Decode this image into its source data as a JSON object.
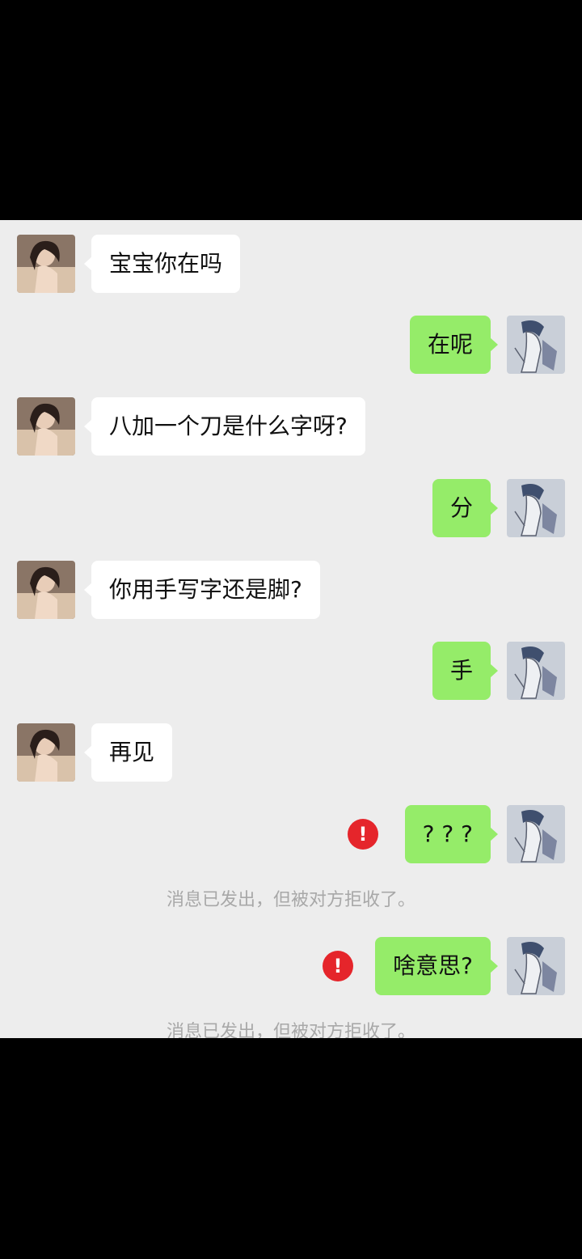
{
  "messages": [
    {
      "side": "in",
      "text": "宝宝你在吗"
    },
    {
      "side": "out",
      "text": "在呢"
    },
    {
      "side": "in",
      "text": "八加一个刀是什么字呀?"
    },
    {
      "side": "out",
      "text": "分"
    },
    {
      "side": "in",
      "text": "你用手写字还是脚?"
    },
    {
      "side": "out",
      "text": "手"
    },
    {
      "side": "in",
      "text": "再见"
    },
    {
      "side": "out",
      "text": "? ? ?",
      "failed": true
    },
    {
      "side": "out",
      "text": "啥意思?",
      "failed": true
    }
  ],
  "system_notices": [
    "消息已发出，但被对方拒收了。",
    "消息已发出，但被对方拒收了。"
  ],
  "error_icon_glyph": "!",
  "colors": {
    "incoming_bubble": "#ffffff",
    "outgoing_bubble": "#95ec69",
    "background": "#ededed",
    "error": "#e5252b"
  },
  "icons": [
    "error-alert-icon",
    "contact-avatar",
    "self-avatar"
  ]
}
